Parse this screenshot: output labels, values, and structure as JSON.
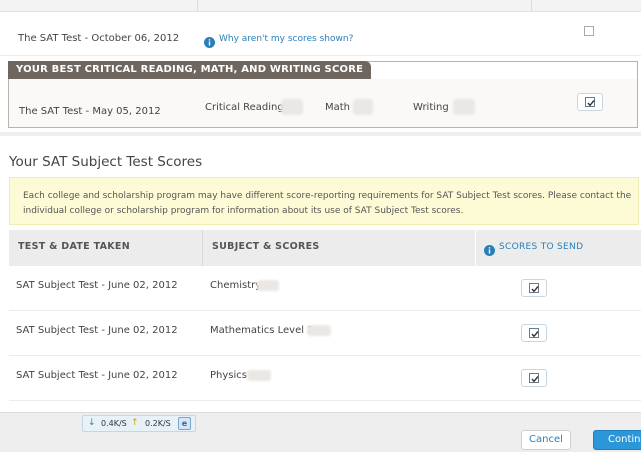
{
  "prior_row": {
    "test_name": "The SAT Test - October 06, 2012",
    "why_link": "Why aren't my scores shown?"
  },
  "best_score": {
    "header": "YOUR BEST CRITICAL READING, MATH, AND WRITING SCORE",
    "test_name": "The SAT Test - May 05, 2012",
    "labels": {
      "critical_reading": "Critical Reading",
      "math": "Math",
      "writing": "Writing"
    },
    "checked": true
  },
  "subject_section": {
    "title": "Your SAT Subject Test Scores",
    "notice": "Each college and scholarship program may have different score-reporting requirements for SAT Subject Test scores. Please contact the individual college or scholarship program for information about its use of SAT Subject Test scores.",
    "columns": {
      "test_date": "TEST & DATE TAKEN",
      "subject": "SUBJECT & SCORES",
      "send": "SCORES TO SEND"
    },
    "rows": [
      {
        "test": "SAT Subject Test - June 02, 2012",
        "subject": "Chemistry",
        "checked": true
      },
      {
        "test": "SAT Subject Test - June 02, 2012",
        "subject": "Mathematics Level 2",
        "checked": true
      },
      {
        "test": "SAT Subject Test - June 02, 2012",
        "subject": "Physics",
        "checked": true
      }
    ]
  },
  "network": {
    "down": "0.4K/S",
    "up": "0.2K/S"
  },
  "buttons": {
    "cancel": "Cancel",
    "continue": "Continue"
  },
  "colors": {
    "link": "#2a7fb8",
    "primary_button": "#2b96d8",
    "header_band": "#6f6660",
    "notice_bg": "#fdfbd6"
  }
}
